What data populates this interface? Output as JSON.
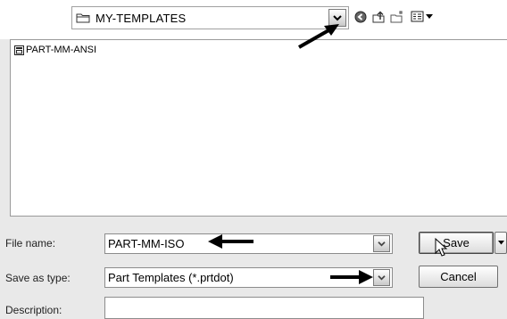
{
  "toolbar": {
    "location": "MY-TEMPLATES",
    "icons": [
      "folder-icon",
      "chevron-down-icon",
      "back-icon",
      "up-folder-icon",
      "new-folder-icon",
      "view-menu-icon"
    ]
  },
  "file_list": {
    "items": [
      {
        "label": "PART-MM-ANSI",
        "icon": "template-file-icon"
      }
    ]
  },
  "form": {
    "file_name_label": "File name:",
    "file_name_value": "PART-MM-ISO",
    "save_as_type_label": "Save as type:",
    "save_as_type_value": "Part Templates (*.prtdot)",
    "description_label": "Description:",
    "description_value": ""
  },
  "buttons": {
    "save_label": "Save",
    "cancel_label": "Cancel"
  }
}
